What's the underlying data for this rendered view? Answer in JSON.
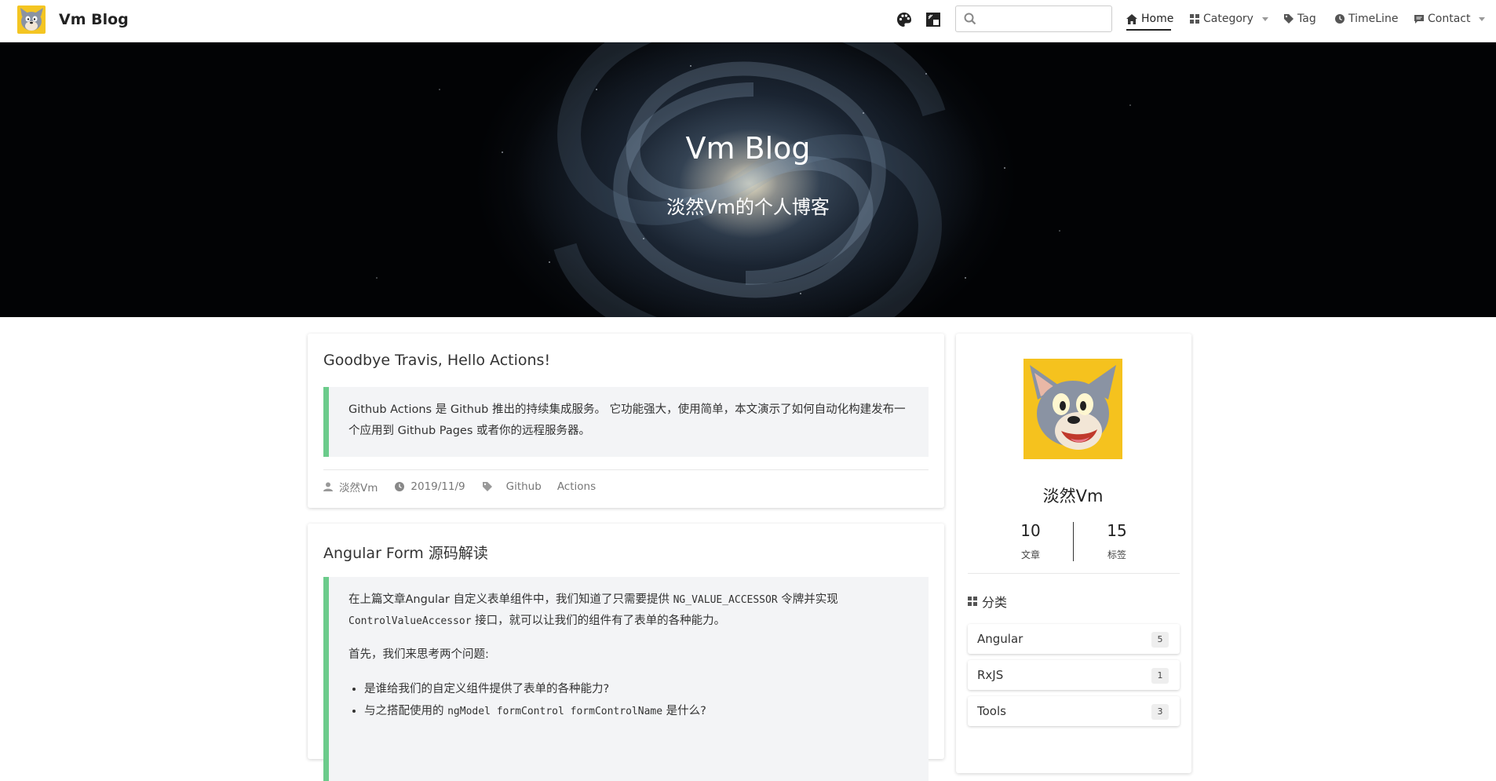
{
  "navbar": {
    "brand": "Vm Blog",
    "search_placeholder": "",
    "items": [
      {
        "label": "Home",
        "icon": "home-icon",
        "active": true
      },
      {
        "label": "Category",
        "icon": "grid-icon",
        "dropdown": true
      },
      {
        "label": "Tag",
        "icon": "tag-icon"
      },
      {
        "label": "TimeLine",
        "icon": "clock-icon"
      },
      {
        "label": "Contact",
        "icon": "message-icon",
        "dropdown": true
      }
    ]
  },
  "hero": {
    "title": "Vm Blog",
    "subtitle": "淡然Vm的个人博客"
  },
  "posts": [
    {
      "title": "Goodbye Travis, Hello Actions!",
      "excerpt_text": "Github Actions 是 Github 推出的持续集成服务。 它功能强大，使用简单，本文演示了如何自动化构建发布一个应用到 Github Pages 或者你的远程服务器。",
      "author": "淡然Vm",
      "date": "2019/11/9",
      "tags": [
        "Github",
        "Actions"
      ]
    },
    {
      "title": "Angular Form 源码解读",
      "p1_pre": "在上篇文章Angular 自定义表单组件中，我们知道了只需要提供 ",
      "p1_code1": "NG_VALUE_ACCESSOR",
      "p1_mid": " 令牌并实现 ",
      "p1_code2": "ControlValueAccessor",
      "p1_post": " 接口，就可以让我们的组件有了表单的各种能力。",
      "p2": "首先，我们来思考两个问题:",
      "li1": "是谁给我们的自定义组件提供了表单的各种能力?",
      "li2_pre": "与之搭配使用的 ",
      "li2_code": "ngModel formControl formControlName",
      "li2_post": " 是什么?"
    }
  ],
  "profile": {
    "name": "淡然Vm",
    "posts_count": "10",
    "posts_label": "文章",
    "tags_count": "15",
    "tags_label": "标签"
  },
  "categories": {
    "heading": "分类",
    "items": [
      {
        "name": "Angular",
        "count": "5"
      },
      {
        "name": "RxJS",
        "count": "1"
      },
      {
        "name": "Tools",
        "count": "3"
      }
    ]
  },
  "colors": {
    "quote_border": "#6bcb8b",
    "quote_bg": "#f3f4f6",
    "avatar_bg": "#f5c21e"
  }
}
